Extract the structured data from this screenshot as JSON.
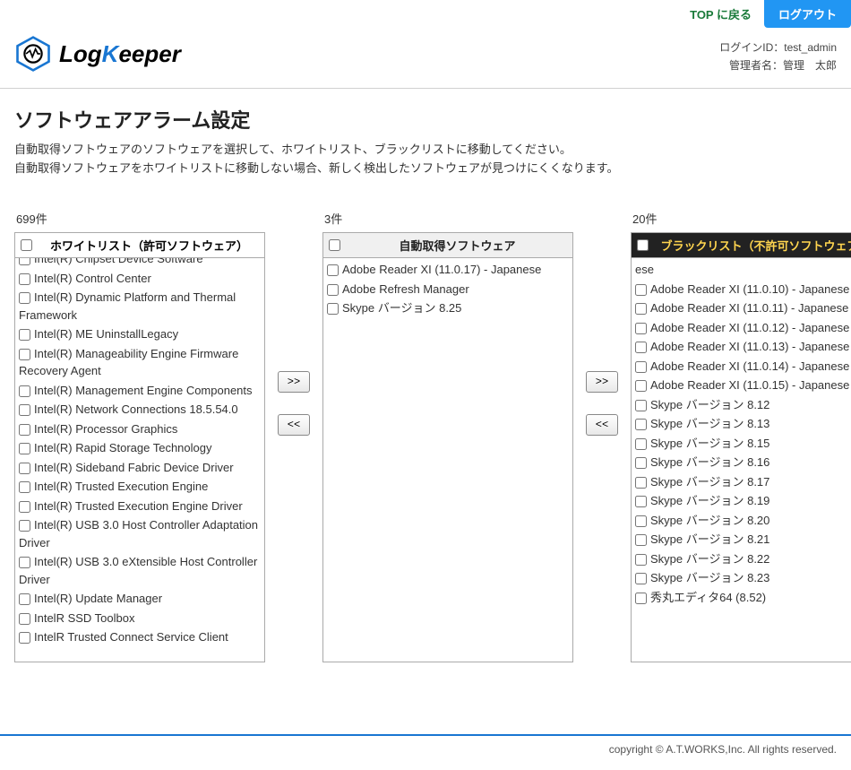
{
  "header": {
    "top_link": "TOP に戻る",
    "logout": "ログアウト",
    "login_id_label": "ログインID：",
    "login_id": "test_admin",
    "admin_name_label": "管理者名：",
    "admin_name": "管理　太郎",
    "logo_log": "Log",
    "logo_k": "K",
    "logo_eeper": "eeper"
  },
  "page": {
    "title": "ソフトウェアアラーム設定",
    "desc_line1": "自動取得ソフトウェアのソフトウェアを選択して、ホワイトリスト、ブラックリストに移動してください。",
    "desc_line2": "自動取得ソフトウェアをホワイトリストに移動しない場合、新しく検出したソフトウェアが見つけにくくなります。"
  },
  "columns": {
    "whitelist": {
      "count": "699件",
      "title": "ホワイトリスト（許可ソフトウェア）",
      "items": [
        "Intel(R) Chipset Device Software",
        "Intel(R) Control Center",
        "Intel(R) Dynamic Platform and Thermal Framework",
        "Intel(R) ME UninstallLegacy",
        "Intel(R) Manageability Engine Firmware Recovery Agent",
        "Intel(R) Management Engine Components",
        "Intel(R) Network Connections 18.5.54.0",
        "Intel(R) Processor Graphics",
        "Intel(R) Rapid Storage Technology",
        "Intel(R) Sideband Fabric Device Driver",
        "Intel(R) Trusted Execution Engine",
        "Intel(R) Trusted Execution Engine Driver",
        "Intel(R) USB 3.0 Host Controller Adaptation Driver",
        "Intel(R) USB 3.0 eXtensible Host Controller Driver",
        "Intel(R) Update Manager",
        "IntelR SSD Toolbox",
        "IntelR Trusted Connect Service Client"
      ]
    },
    "auto": {
      "count": "3件",
      "title": "自動取得ソフトウェア",
      "items": [
        "Adobe Reader XI (11.0.17) - Japanese",
        "Adobe Refresh Manager",
        "Skype バージョン 8.25"
      ]
    },
    "blacklist": {
      "count": "20件",
      "title": "ブラックリスト（不許可ソフトウェア）",
      "items": [
        "ese",
        "Adobe Reader XI (11.0.10) - Japanese",
        "Adobe Reader XI (11.0.11) - Japanese",
        "Adobe Reader XI (11.0.12) - Japanese",
        "Adobe Reader XI (11.0.13) - Japanese",
        "Adobe Reader XI (11.0.14) - Japanese",
        "Adobe Reader XI (11.0.15) - Japanese",
        "Skype バージョン 8.12",
        "Skype バージョン 8.13",
        "Skype バージョン 8.15",
        "Skype バージョン 8.16",
        "Skype バージョン 8.17",
        "Skype バージョン 8.19",
        "Skype バージョン 8.20",
        "Skype バージョン 8.21",
        "Skype バージョン 8.22",
        "Skype バージョン 8.23",
        "秀丸エディタ64 (8.52)"
      ]
    }
  },
  "buttons": {
    "right": ">>",
    "left": "<<"
  },
  "footer": {
    "copyright": "copyright © A.T.WORKS,Inc. All rights reserved."
  }
}
